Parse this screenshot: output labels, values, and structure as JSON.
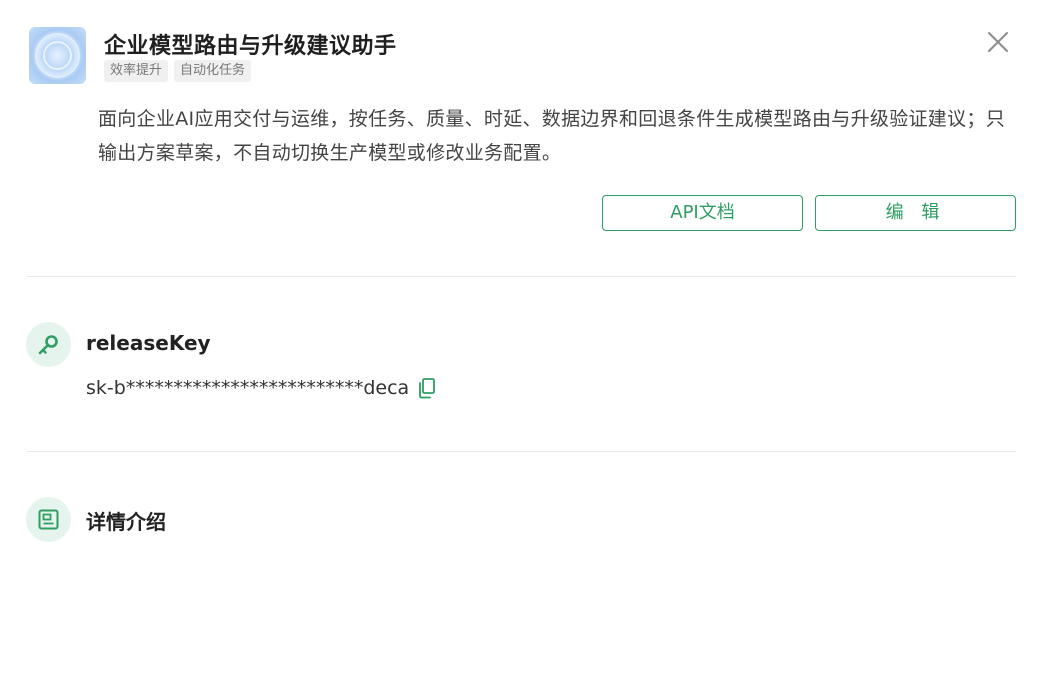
{
  "app": {
    "title": "企业模型路由与升级建议助手",
    "tags": [
      "效率提升",
      "自动化任务"
    ],
    "description": "面向企业AI应用交付与运维，按任务、质量、时延、数据边界和回退条件生成模型路由与升级验证建议；只输出方案草案，不自动切换生产模型或修改业务配置。",
    "icon": "app-avatar-icon"
  },
  "actions": {
    "api_docs_label": "API文档",
    "edit_label": "编 辑",
    "close_icon": "close-icon"
  },
  "release_key": {
    "title": "releaseKey",
    "value": "sk-b*************************deca",
    "icon": "key-icon",
    "copy_icon": "copy-icon"
  },
  "details": {
    "title": "详情介绍",
    "icon": "document-icon"
  },
  "colors": {
    "accent": "#2e9e63",
    "accent_bg": "#e5f4ec",
    "tag_bg": "#f0f0f0",
    "divider": "#e8e8e8"
  }
}
